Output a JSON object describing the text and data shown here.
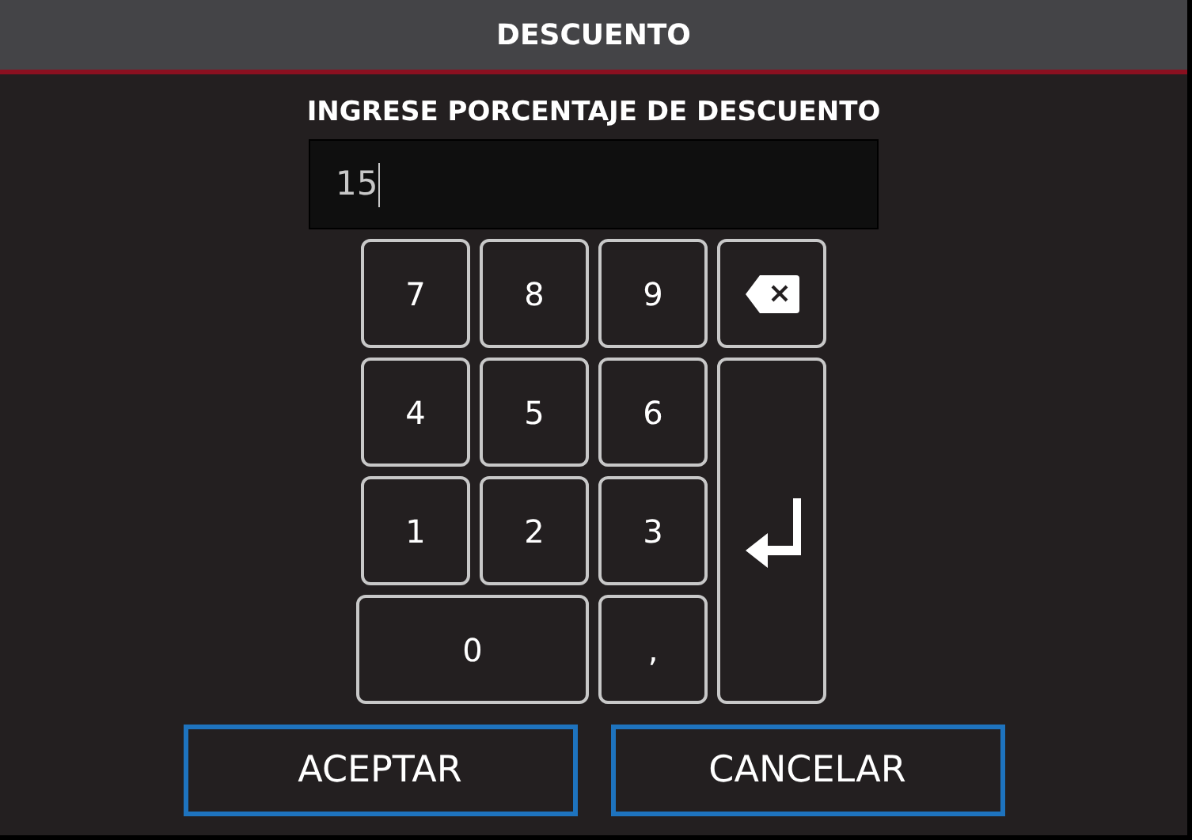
{
  "window": {
    "title": "DESCUENTO"
  },
  "prompt": "INGRESE PORCENTAJE DE DESCUENTO",
  "field": {
    "value": "15"
  },
  "keys": [
    {
      "kind": "digit",
      "label": "7"
    },
    {
      "kind": "digit",
      "label": "8"
    },
    {
      "kind": "digit",
      "label": "9"
    },
    {
      "kind": "backspace"
    },
    {
      "kind": "digit",
      "label": "4"
    },
    {
      "kind": "digit",
      "label": "5"
    },
    {
      "kind": "digit",
      "label": "6"
    },
    {
      "kind": "enter"
    },
    {
      "kind": "digit",
      "label": "1"
    },
    {
      "kind": "digit",
      "label": "2"
    },
    {
      "kind": "digit",
      "label": "3"
    },
    {
      "kind": "wide",
      "label": "0"
    },
    {
      "kind": "digit",
      "label": ","
    }
  ],
  "buttons": [
    {
      "label": "ACEPTAR"
    },
    {
      "label": "CANCELAR"
    }
  ]
}
